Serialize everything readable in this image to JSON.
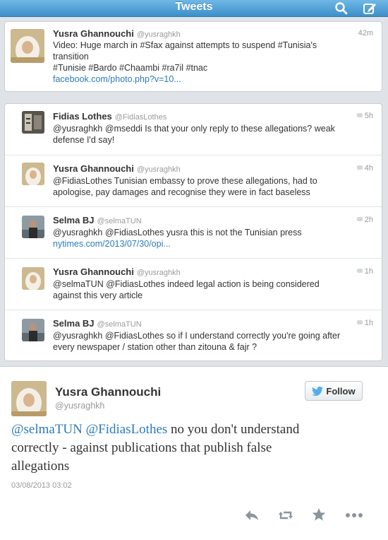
{
  "header": {
    "title": "Tweets"
  },
  "top_tweet": {
    "name": "Yusra Ghannouchi",
    "handle": "@yusraghkh",
    "time": "42m",
    "lines": [
      "Video: Huge march in #Sfax against attempts to suspend #Tunisia's",
      "transition",
      "#Tunisie #Bardo #Chaambi #ra7il #tnac"
    ],
    "link": "facebook.com/photo.php?v=10..."
  },
  "replies": [
    {
      "name": "Fidias Lothes",
      "handle": "@FidiasLothes",
      "time": "5h",
      "lines": [
        "@yusraghkh @mseddi Is that your only reply to these allegations? weak",
        "defense I'd say!"
      ]
    },
    {
      "name": "Yusra Ghannouchi",
      "handle": "@yusraghkh",
      "time": "4h",
      "lines": [
        "@FidiasLothes Tunisian embassy to prove these allegations, had to",
        "apologise, pay damages and recognise they were in fact baseless"
      ]
    },
    {
      "name": "Selma BJ",
      "handle": "@selmaTUN",
      "time": "2h",
      "lines": [
        "@yusraghkh @FidiasLothes yusra this is not the Tunisian press"
      ],
      "link": "nytimes.com/2013/07/30/opi..."
    },
    {
      "name": "Yusra Ghannouchi",
      "handle": "@yusraghkh",
      "time": "1h",
      "lines": [
        "@selmaTUN @FidiasLothes indeed legal action is being considered",
        "against this very article"
      ]
    },
    {
      "name": "Selma BJ",
      "handle": "@selmaTUN",
      "time": "1h",
      "lines": [
        "@yusraghkh @FidiasLothes so if I understand correctly you're going after",
        "every newspaper / station other than zitouna & fajr ?"
      ]
    }
  ],
  "detail": {
    "name": "Yusra Ghannouchi",
    "handle": "@yusraghkh",
    "follow_label": "Follow",
    "mention_1": "@selmaTUN",
    "mention_2": "@FidiasLothes",
    "text_line_1": " no you don't understand",
    "text_line_2": "correctly - against publications that publish false",
    "text_line_3": "allegations",
    "date": "03/08/2013 03:02"
  },
  "icons": {
    "header": [
      "search-icon",
      "compose-icon"
    ],
    "actions": [
      "reply-icon",
      "retweet-icon",
      "favorite-icon",
      "more-icon"
    ]
  },
  "colors": {
    "accent": "#3d8fcb",
    "link": "#2b7bb9",
    "background": "#dfe3e7"
  }
}
